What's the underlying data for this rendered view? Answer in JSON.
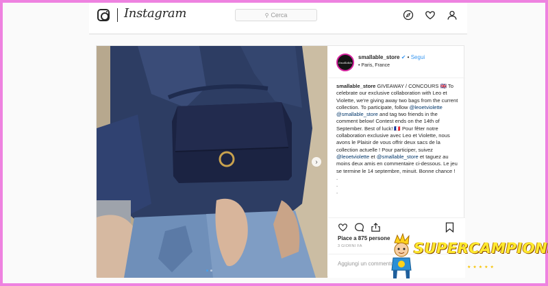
{
  "header": {
    "brand": "Instagram",
    "search_placeholder": "Cerca",
    "icons": [
      "instagram-camera-icon",
      "compass-icon",
      "heart-icon",
      "profile-icon"
    ]
  },
  "post": {
    "username": "smallable_store",
    "follow_separator": "•",
    "follow_label": "Segui",
    "location": "• Paris, France",
    "avatar_text": "Smallable",
    "caption": {
      "author": "smallable_store",
      "p1": " GIVEAWAY / CONCOURS 🇬🇧 To celebrate our exclusive collaboration with Leo et Violette, we're giving away two bags from the current collection. To participate, follow ",
      "m1": "@leoetviolette",
      "p2": " ",
      "m2": "@smallable_store",
      "p3": " and tag two friends in the comment below! Contest ends on the 14th of September. Best of luck! 🇫🇷 Pour fêter notre collaboration exclusive avec Leo et Violette, nous avons le Plaisir de vous offrir deux sacs de la collection actuelle ! Pour participer, suivez ",
      "m3": "@leoetviolette",
      "p4": " et ",
      "m4": "@smallable_store",
      "p5": " et taguez au moins deux amis en commentaire ci-dessous. Le jeu se termine le 14 septembre, minuit. Bonne chance !",
      "dots": ".\n.\n."
    },
    "likes": "Piace a 875 persone",
    "time_ago": "3 GIORNI FA",
    "comment_placeholder": "Aggiungi un commento...",
    "carousel_next": "›"
  },
  "watermark": {
    "part1": "SUPER",
    "part2": "CAMPIONE",
    "stars": "★★★★★"
  },
  "colors": {
    "border_frame": "#ee82e0",
    "link_blue": "#3897f0",
    "mention_blue": "#003569",
    "watermark_yellow": "#ffd21a"
  }
}
